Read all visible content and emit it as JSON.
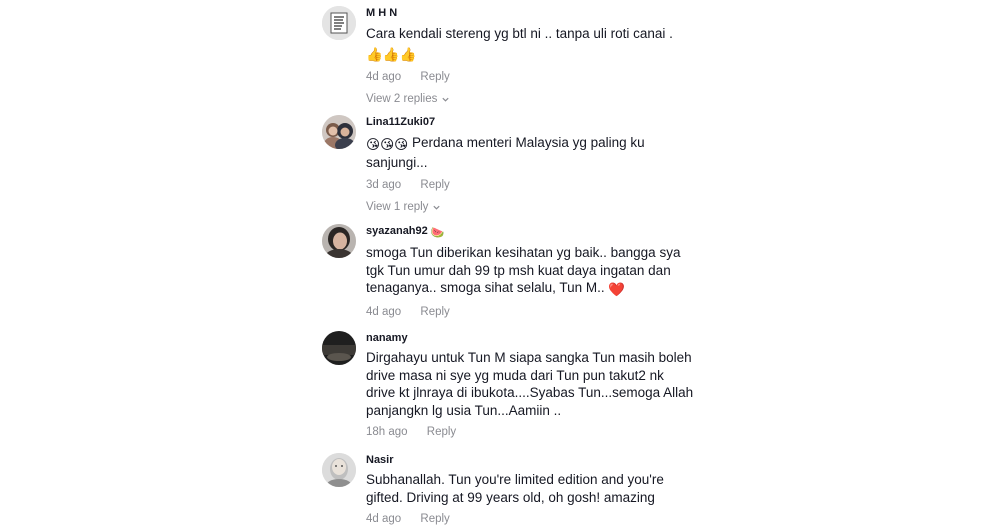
{
  "comments": [
    {
      "username": "M H N",
      "text": "Cara kendali stereng yg btl ni .. tanpa uli roti canai .",
      "emoji_line": "👍👍👍",
      "time": "4d ago",
      "reply": "Reply",
      "view_replies": "View 2 replies"
    },
    {
      "username": "Lina11Zuki07",
      "text": "Perdana menteri Malaysia yg paling ku sanjungi...",
      "emoji_prefix": "😘😘😘",
      "time": "3d ago",
      "reply": "Reply",
      "view_replies": "View 1 reply"
    },
    {
      "username": "syazanah92",
      "username_emoji": "🍉",
      "text": "smoga Tun diberikan kesihatan yg baik.. bangga sya tgk Tun umur dah 99 tp msh kuat daya ingatan dan tenaganya.. smoga sihat selalu, Tun M..",
      "emoji_suffix": "❤️",
      "time": "4d ago",
      "reply": "Reply"
    },
    {
      "username": "nanamy",
      "text": "Dirgahayu untuk Tun M siapa sangka Tun masih boleh drive masa ni sye yg muda dari Tun pun takut2 nk drive kt jlnraya di ibukota....Syabas Tun...semoga Allah panjangkn lg usia Tun...Aamiin ..",
      "time": "18h ago",
      "reply": "Reply"
    },
    {
      "username": "Nasir",
      "text": "Subhanallah. Tun you're limited edition and you're gifted. Driving at 99 years old, oh gosh! amazing",
      "time": "4d ago",
      "reply": "Reply"
    }
  ],
  "colors": {
    "text": "#161823",
    "meta": "#8a8b91",
    "background": "#ffffff"
  },
  "icons": {
    "chevron": "chevron-down-icon"
  }
}
